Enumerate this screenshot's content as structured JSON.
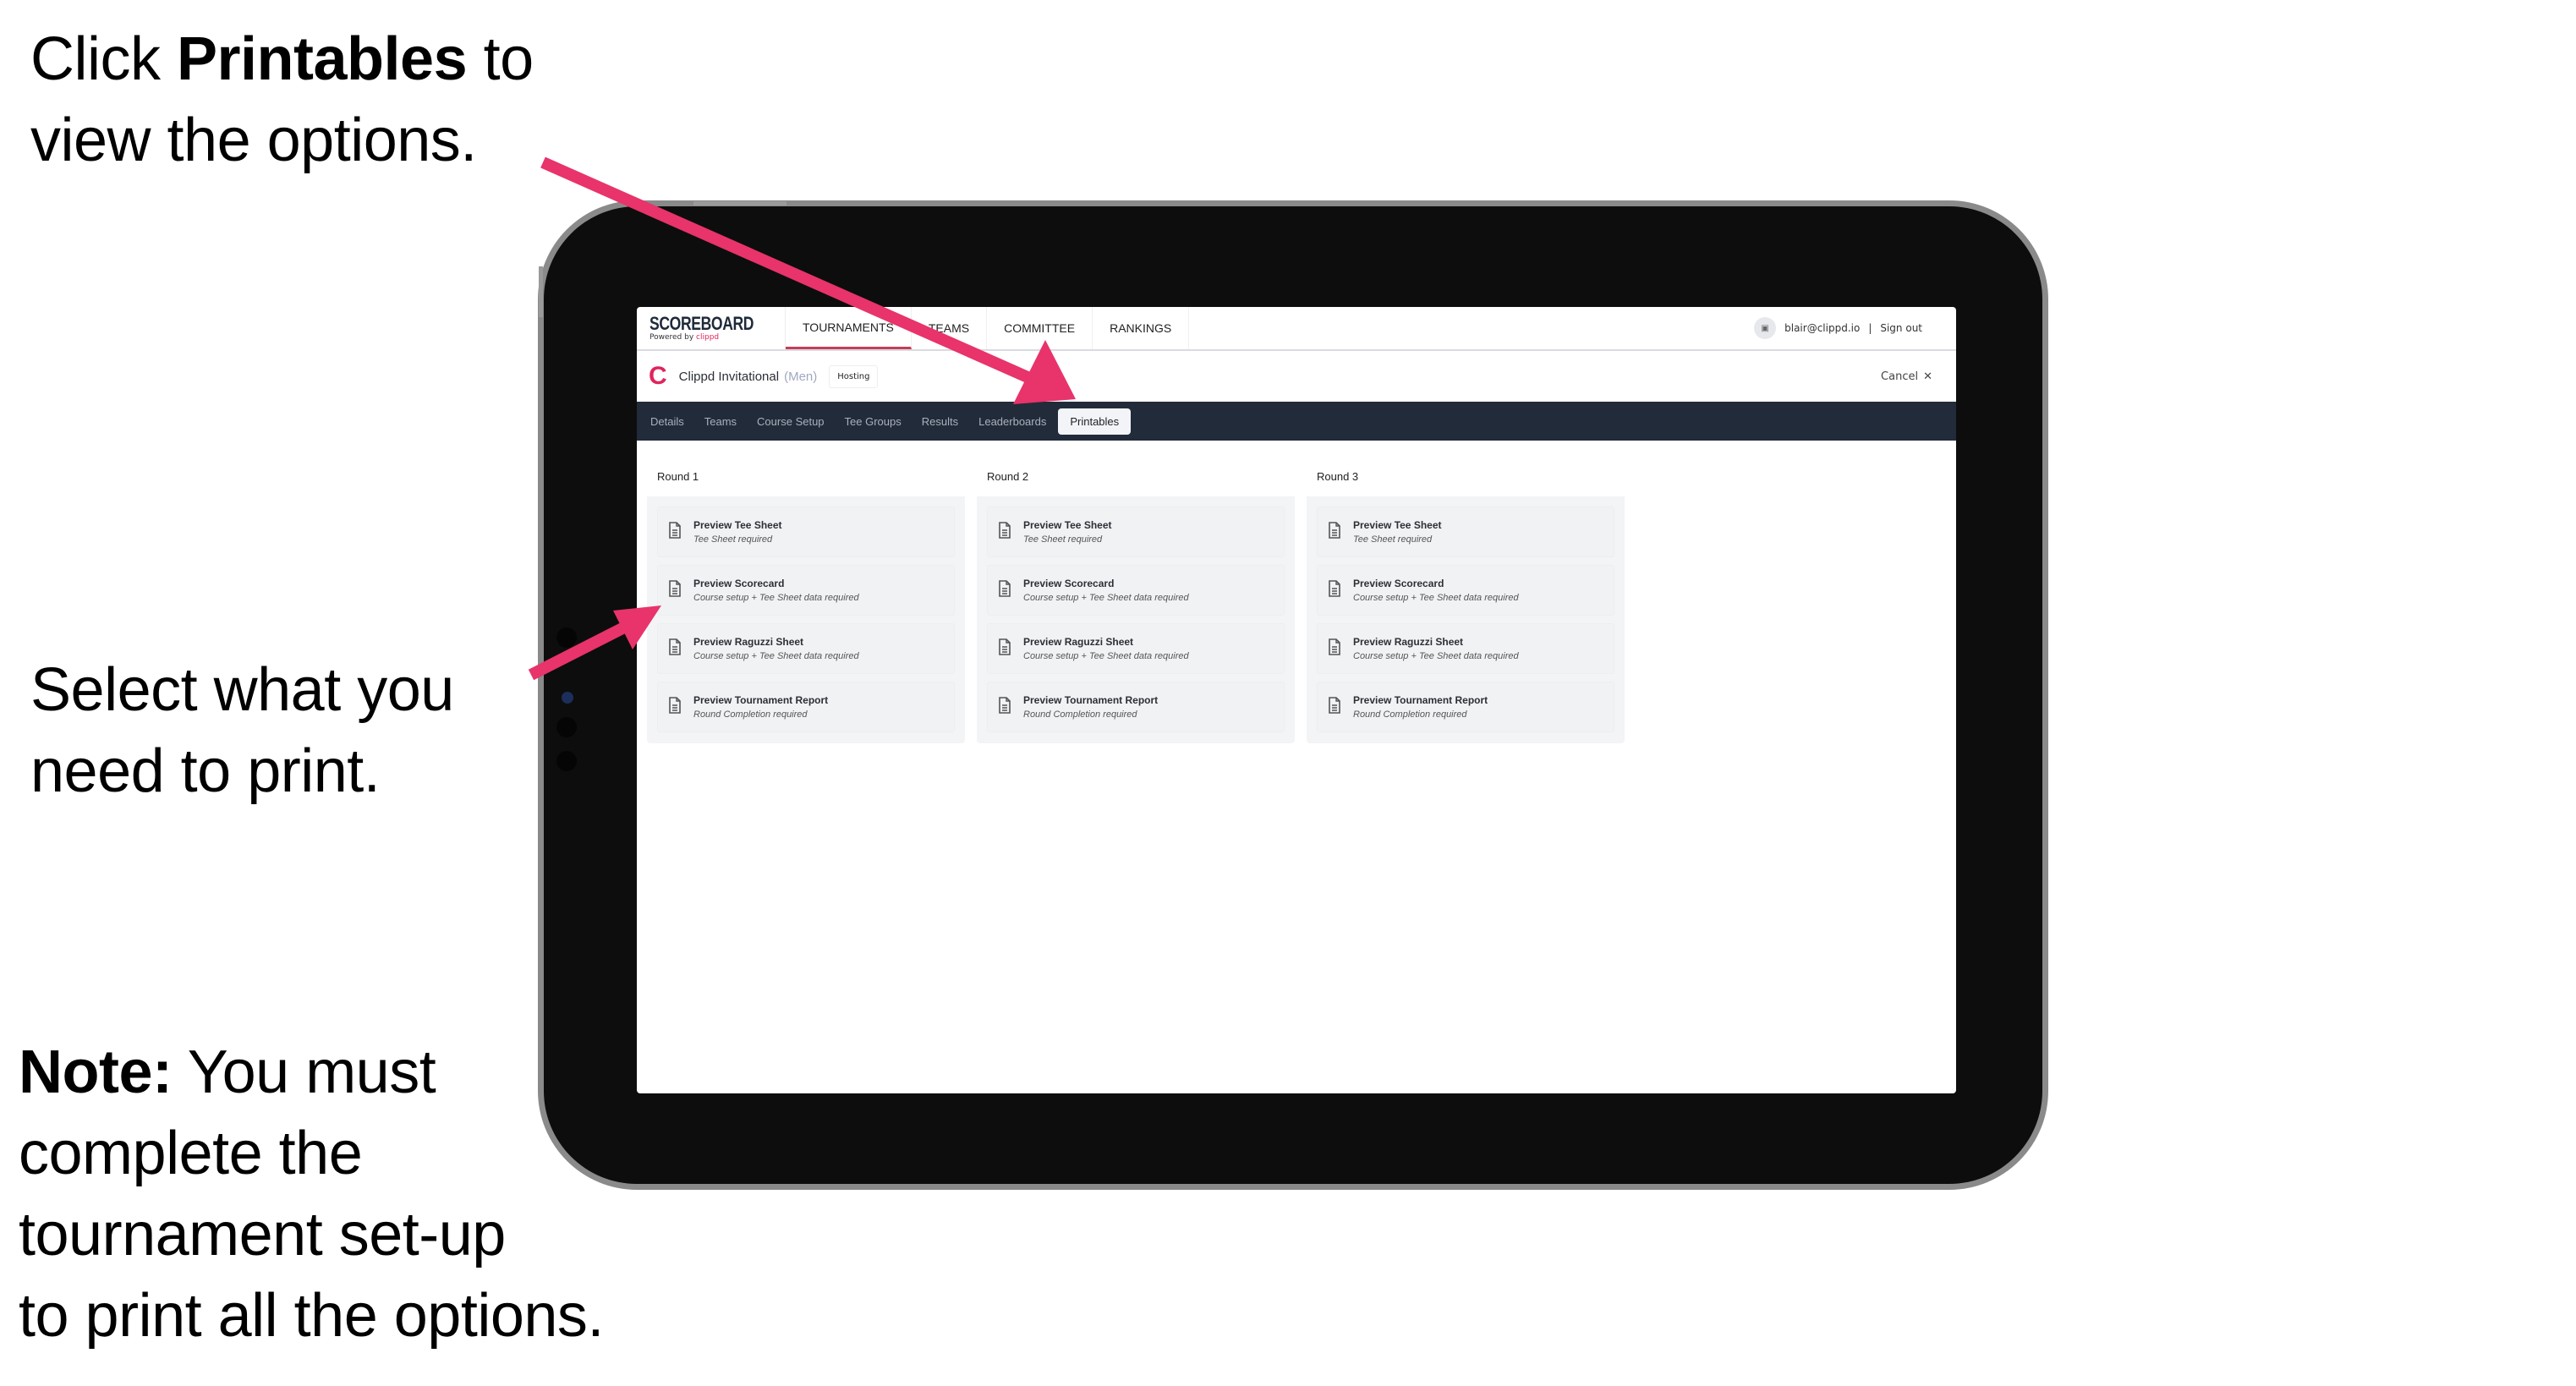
{
  "callouts": {
    "first": {
      "prefix": "Click ",
      "bold": "Printables",
      "suffix": " to",
      "line2": "view the options."
    },
    "second": {
      "line1": "Select what you",
      "line2": "need to print."
    },
    "note": {
      "bold": "Note:",
      "line1": " You must",
      "line2": "complete the",
      "line3": "tournament set-up",
      "line4": "to print all the options."
    }
  },
  "app": {
    "logo_title": "SCOREBOARD",
    "logo_powered": "Powered by ",
    "logo_brand": "clippd",
    "nav": [
      "TOURNAMENTS",
      "TEAMS",
      "COMMITTEE",
      "RANKINGS"
    ],
    "active_nav": "TOURNAMENTS",
    "user_email": "blair@clippd.io",
    "separator": "|",
    "sign_out": "Sign out",
    "avatar_icon": "image-icon"
  },
  "tournament": {
    "logo_letter": "C",
    "name": "Clippd Invitational",
    "gender": "(Men)",
    "badge": "Hosting",
    "cancel": "Cancel",
    "cancel_icon": "✕"
  },
  "tabs": [
    "Details",
    "Teams",
    "Course Setup",
    "Tee Groups",
    "Results",
    "Leaderboards",
    "Printables"
  ],
  "active_tab": "Printables",
  "rounds": [
    {
      "title": "Round 1",
      "items": [
        {
          "title": "Preview Tee Sheet",
          "sub": "Tee Sheet required"
        },
        {
          "title": "Preview Scorecard",
          "sub": "Course setup + Tee Sheet data required"
        },
        {
          "title": "Preview Raguzzi Sheet",
          "sub": "Course setup + Tee Sheet data required"
        },
        {
          "title": "Preview Tournament Report",
          "sub": "Round Completion required"
        }
      ]
    },
    {
      "title": "Round 2",
      "items": [
        {
          "title": "Preview Tee Sheet",
          "sub": "Tee Sheet required"
        },
        {
          "title": "Preview Scorecard",
          "sub": "Course setup + Tee Sheet data required"
        },
        {
          "title": "Preview Raguzzi Sheet",
          "sub": "Course setup + Tee Sheet data required"
        },
        {
          "title": "Preview Tournament Report",
          "sub": "Round Completion required"
        }
      ]
    },
    {
      "title": "Round 3",
      "items": [
        {
          "title": "Preview Tee Sheet",
          "sub": "Tee Sheet required"
        },
        {
          "title": "Preview Scorecard",
          "sub": "Course setup + Tee Sheet data required"
        },
        {
          "title": "Preview Raguzzi Sheet",
          "sub": "Course setup + Tee Sheet data required"
        },
        {
          "title": "Preview Tournament Report",
          "sub": "Round Completion required"
        }
      ]
    }
  ],
  "colors": {
    "accent": "#e8336b",
    "tabbar": "#222b3a",
    "brand": "#e0245e"
  }
}
